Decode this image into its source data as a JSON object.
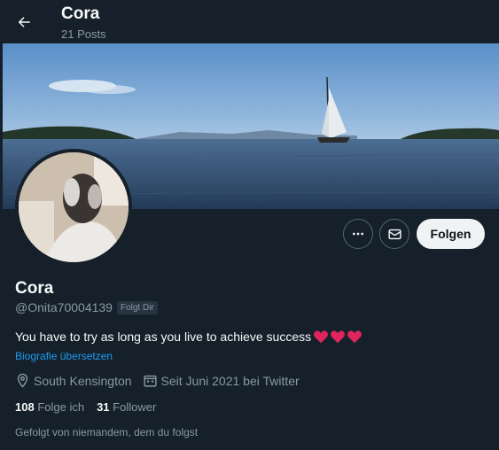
{
  "header": {
    "name": "Cora",
    "posts_count": "21 Posts"
  },
  "profile": {
    "display_name": "Cora",
    "handle": "@Onita70004139",
    "follows_you_badge": "Folgt Dir",
    "bio": "You have to try as long as you live to achieve success",
    "bio_emojis": [
      "heart",
      "heart",
      "heart"
    ],
    "translate_link": "Biografie übersetzen",
    "location": "South Kensington",
    "joined": "Seit Juni 2021 bei Twitter",
    "following_count": "108",
    "following_label": "Folge ich",
    "followers_count": "31",
    "followers_label": "Follower",
    "followed_by_text": "Gefolgt von niemandem, dem du folgst"
  },
  "actions": {
    "more_icon": "more-icon",
    "message_icon": "mail-icon",
    "follow_label": "Folgen"
  },
  "colors": {
    "background": "#15202b",
    "accent": "#1d9bf0",
    "secondary_text": "#8b98a5",
    "heart": "#e0245e"
  }
}
